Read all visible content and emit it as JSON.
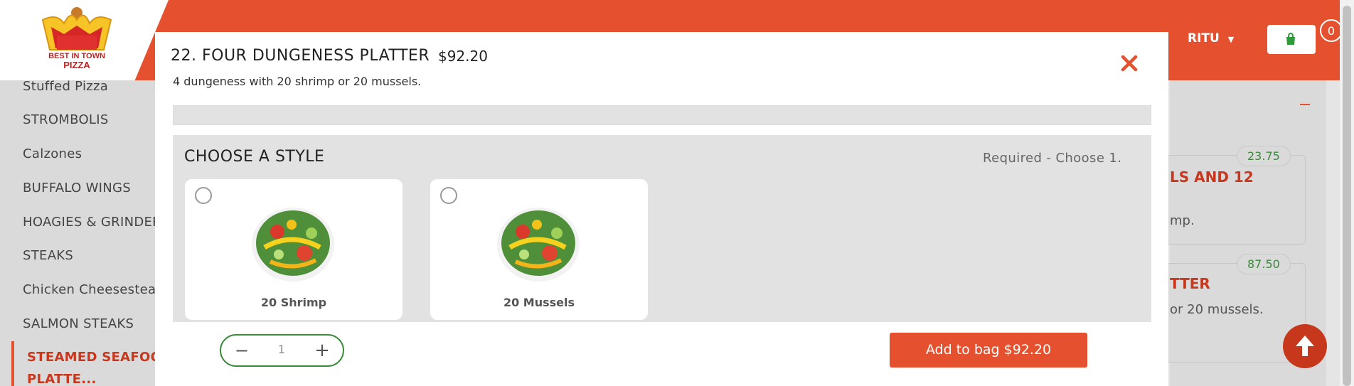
{
  "header": {
    "logo_text_line1": "BEST IN TOWN",
    "logo_text_line2": "PIZZA",
    "user_label": "RITU",
    "cart_count": "0"
  },
  "sidebar": {
    "items": [
      {
        "label": "Stuffed Pizza"
      },
      {
        "label": "STROMBOLIS"
      },
      {
        "label": "Calzones"
      },
      {
        "label": "BUFFALO WINGS"
      },
      {
        "label": "HOAGIES & GRINDERS"
      },
      {
        "label": "STEAKS"
      },
      {
        "label": "Chicken Cheesesteak"
      },
      {
        "label": "SALMON STEAKS"
      }
    ],
    "active_line1": "STEAMED SEAFOOD",
    "active_line2": "PLATTE..."
  },
  "background_menu": {
    "card1_price": "23.75",
    "card1_title_fragment": "LS AND 12",
    "card1_desc_fragment": "mp.",
    "card2_price": "87.50",
    "card2_title_fragment": "TTER",
    "card2_desc_fragment": "or 20 mussels."
  },
  "modal": {
    "title": "22. FOUR DUNGENESS PLATTER",
    "price": "$92.20",
    "description": "4 dungeness with 20 shrimp or 20 mussels.",
    "section_title": "CHOOSE A STYLE",
    "required_text": "Required - Choose 1.",
    "options": [
      {
        "label": "20 Shrimp"
      },
      {
        "label": "20 Mussels"
      }
    ],
    "quantity": "1",
    "add_button_label": "Add to bag $92.20"
  },
  "colors": {
    "brand": "#e5502e",
    "accent_green": "#3a8a3a"
  }
}
